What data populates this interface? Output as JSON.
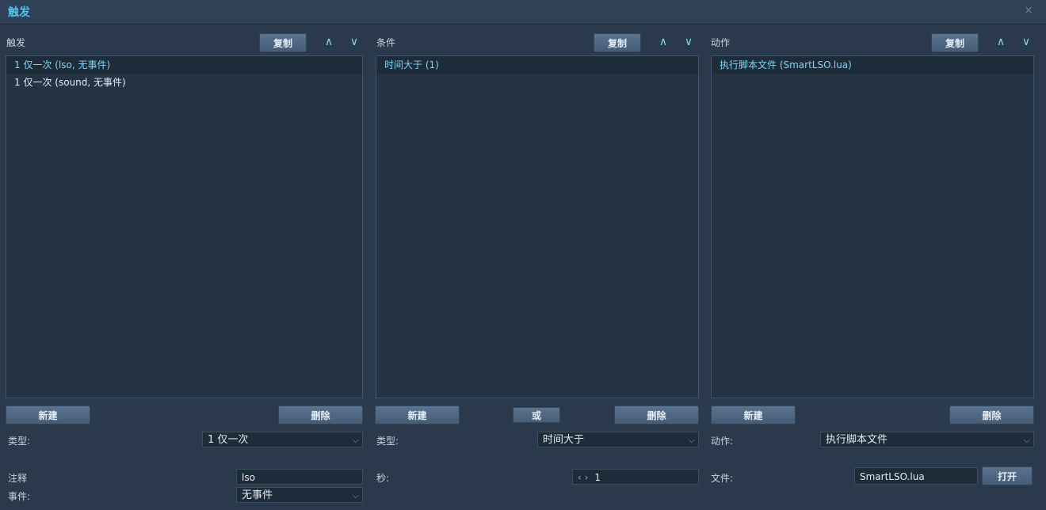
{
  "window": {
    "title": "触发",
    "close_icon": "close-icon"
  },
  "triggers": {
    "label": "触发",
    "copy_label": "复制",
    "items": [
      "1 仅一次 (lso, 无事件)",
      "1 仅一次 (sound, 无事件)"
    ],
    "selected_index": 0,
    "new_label": "新建",
    "delete_label": "删除",
    "type_label": "类型:",
    "type_value": "1 仅一次",
    "comment_label": "注释",
    "comment_value": "lso",
    "event_label": "事件:",
    "event_value": "无事件"
  },
  "conditions": {
    "label": "条件",
    "copy_label": "复制",
    "items": [
      "时间大于 (1)"
    ],
    "selected_index": 0,
    "new_label": "新建",
    "or_label": "或",
    "delete_label": "删除",
    "type_label": "类型:",
    "type_value": "时间大于",
    "seconds_label": "秒:",
    "seconds_arrows": "‹ ›",
    "seconds_value": "1"
  },
  "actions": {
    "label": "动作",
    "copy_label": "复制",
    "items": [
      "执行脚本文件 (SmartLSO.lua)"
    ],
    "selected_index": 0,
    "new_label": "新建",
    "delete_label": "删除",
    "action_label": "动作:",
    "action_value": "执行脚本文件",
    "file_label": "文件:",
    "file_value": "SmartLSO.lua",
    "open_label": "打开"
  },
  "icons": {
    "up": "∧",
    "down": "∨",
    "dropdown": "⌵",
    "close": "×"
  },
  "colors": {
    "accent": "#4fc4f0",
    "background": "#2a3a4c",
    "list_bg": "#253445",
    "selected_bg": "#1e2b38"
  }
}
